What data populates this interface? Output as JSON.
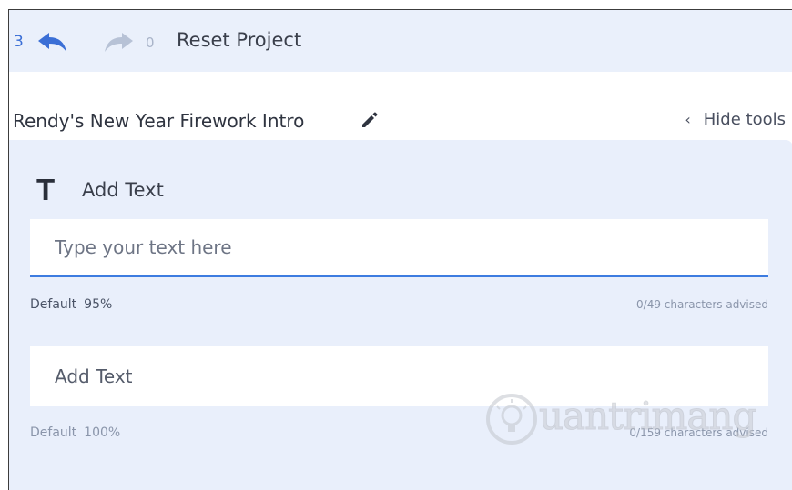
{
  "topbar": {
    "undo_count": "3",
    "redo_count": "0",
    "reset_label": "Reset Project"
  },
  "titlebar": {
    "project_title": "Rendy's New Year Firework Intro",
    "hide_tools_label": "Hide tools",
    "hide_tools_chevron": "‹"
  },
  "panel": {
    "icon_glyph": "T",
    "title": "Add Text",
    "field1": {
      "placeholder": "Type your text here",
      "value": "",
      "style_label": "Default",
      "size_label": "95%",
      "advice": "0/49 characters advised"
    },
    "field2": {
      "placeholder": "Add Text",
      "value": "",
      "style_label": "Default",
      "size_label": "100%",
      "advice": "0/159 characters advised"
    }
  },
  "watermark": {
    "text": "uantrimang"
  },
  "icons": {
    "undo": "undo-arrow-icon",
    "redo": "redo-arrow-icon",
    "edit": "pencil-icon",
    "text": "text-t-icon",
    "watermark_logo": "lightbulb-icon"
  },
  "colors": {
    "accent": "#3b6fd6",
    "input_underline": "#3d7ce0",
    "panel_bg": "#e9effb",
    "topbar_bg": "#eaf0fb"
  }
}
